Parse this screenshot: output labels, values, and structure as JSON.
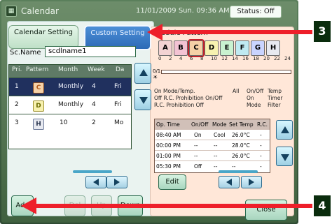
{
  "window": {
    "title": "Calendar",
    "datetime": "11/01/2009 Sun. 09:36 AM",
    "status": "Status: Off"
  },
  "tabs": {
    "calendar_setting": "Calendar Setting",
    "custom_setting": "Custom Setting"
  },
  "left": {
    "sc_name_label": "Sc.Name",
    "sc_name_value": "scdlname1",
    "table": {
      "headers": [
        "Pri.",
        "Pattern",
        "Month",
        "Week",
        "Da"
      ],
      "rows": [
        {
          "pri": "1",
          "pattern": "C",
          "month": "Monthly",
          "week": "4",
          "da": "Fri"
        },
        {
          "pri": "2",
          "pattern": "D",
          "month": "Monthly",
          "week": "4",
          "da": "Fri"
        },
        {
          "pri": "3",
          "pattern": "H",
          "month": "10",
          "week": "2",
          "da": "Mo"
        }
      ]
    },
    "buttons": {
      "add": "Add",
      "del": "Del",
      "up": "Up",
      "down": "Down"
    }
  },
  "right": {
    "schedule_pattern_title": "chedule Pattern",
    "pattern_tabs": [
      "A",
      "B",
      "C",
      "D",
      "E",
      "F",
      "G",
      "H"
    ],
    "time_ticks": [
      "0",
      "2",
      "4",
      "6",
      "8",
      "10",
      "12",
      "14",
      "16",
      "18",
      "20",
      "22",
      "24"
    ],
    "row_labels": [
      "0/1",
      "☀"
    ],
    "legend": [
      "On  Mode/Temp.",
      "Off  R.C. Prohibition On/Off",
      "R.C. Prohibition Off",
      "All",
      "On/Off",
      "Temp",
      "On",
      "Timer",
      "Mode",
      "Filter"
    ],
    "table": {
      "headers": [
        "Op. Time",
        "On/Off",
        "Mode",
        "Set Temp",
        "R.C."
      ],
      "rows": [
        [
          "08:40 AM",
          "On",
          "Cool",
          "26.0°C",
          "-"
        ],
        [
          "00:00 PM",
          "--",
          "--",
          "28.0°C",
          "-"
        ],
        [
          "01:00 PM",
          "--",
          "--",
          "26.0°C",
          "-"
        ],
        [
          "05:30 PM",
          "Off",
          "--",
          "--",
          "-"
        ]
      ]
    },
    "buttons": {
      "edit": "Edit",
      "close": "Close"
    }
  },
  "callouts": {
    "three": "3",
    "four": "4"
  },
  "colors": {
    "callout_red": "#ee1f2a",
    "callout_bg": "#0a2c0d"
  }
}
